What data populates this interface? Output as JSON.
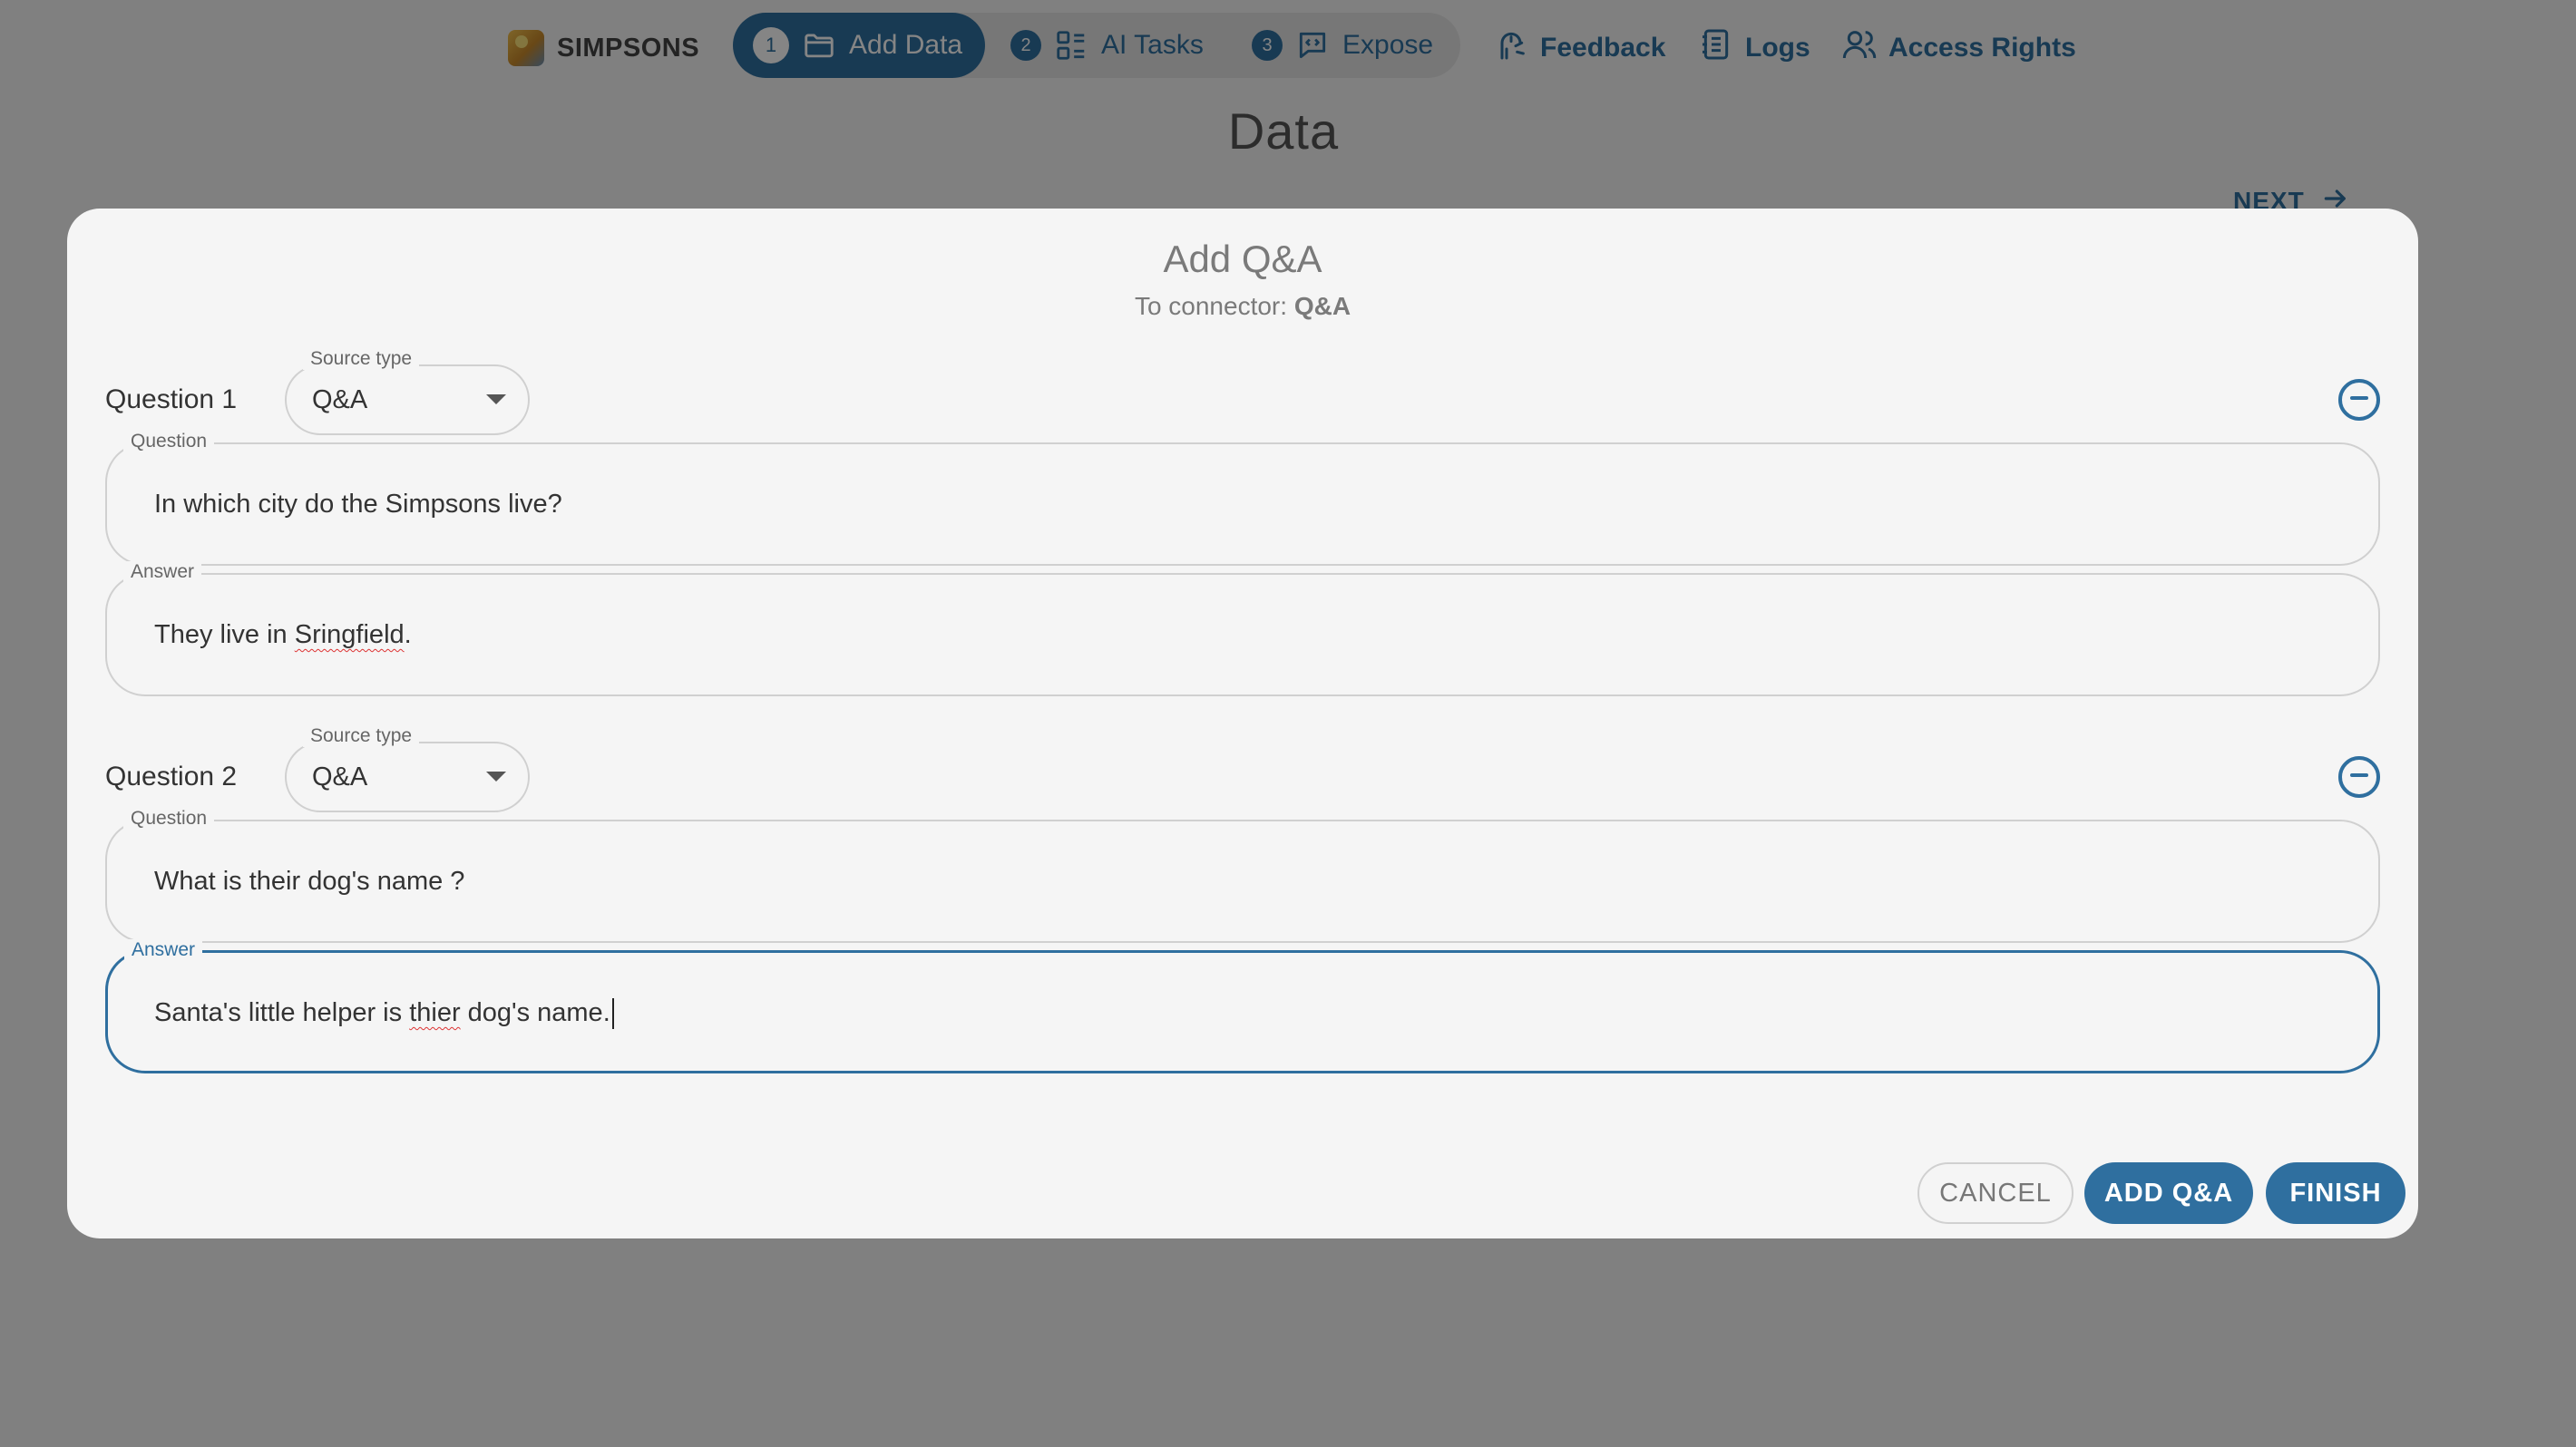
{
  "nav": {
    "brand": "SIMPSONS",
    "steps": [
      {
        "number": "1",
        "label": "Add Data",
        "icon": "folder-icon",
        "active": true
      },
      {
        "number": "2",
        "label": "AI Tasks",
        "icon": "tasks-icon",
        "active": false
      },
      {
        "number": "3",
        "label": "Expose",
        "icon": "code-chat-icon",
        "active": false
      }
    ],
    "links": [
      {
        "label": "Feedback",
        "icon": "feedback-icon"
      },
      {
        "label": "Logs",
        "icon": "logs-icon"
      },
      {
        "label": "Access Rights",
        "icon": "users-icon"
      }
    ]
  },
  "page": {
    "title": "Data",
    "next_label": "NEXT"
  },
  "dialog": {
    "title": "Add Q&A",
    "subtitle_prefix": "To connector: ",
    "connector": "Q&A",
    "select_legend": "Source type",
    "question_legend": "Question",
    "answer_legend": "Answer",
    "items": [
      {
        "label": "Question 1",
        "source_type": "Q&A",
        "question": "In which city do the Simpsons live?",
        "answer_before": "They live in ",
        "answer_typo": "Sringfield",
        "answer_after": "."
      },
      {
        "label": "Question 2",
        "source_type": "Q&A",
        "question": "What is their dog's name ?",
        "answer_before": "Santa's little helper is ",
        "answer_typo": "thier",
        "answer_after": " dog's name."
      }
    ],
    "buttons": {
      "cancel": "CANCEL",
      "add": "ADD Q&A",
      "finish": "FINISH"
    }
  },
  "colors": {
    "accent": "#2f6f9f",
    "overlay": "rgba(0,0,0,0.48)",
    "surface": "#f5f5f5"
  }
}
